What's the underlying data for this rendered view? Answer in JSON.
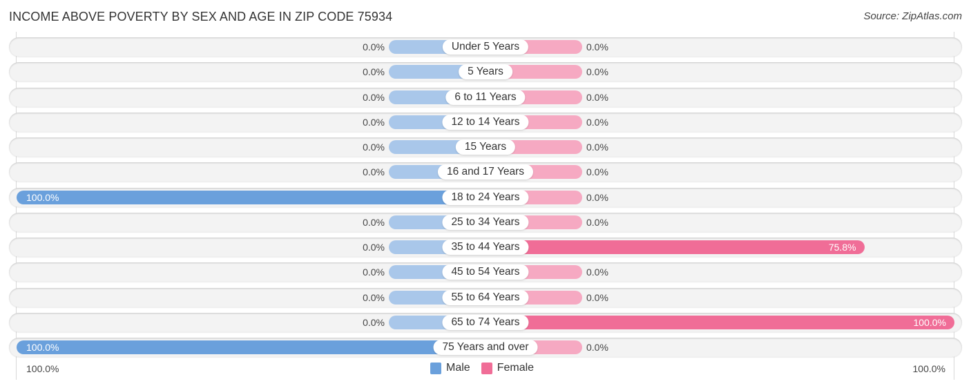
{
  "title": "INCOME ABOVE POVERTY BY SEX AND AGE IN ZIP CODE 75934",
  "source": "Source: ZipAtlas.com",
  "colors": {
    "male": "#6aa0dc",
    "male_zero": "#a9c7ea",
    "female": "#f06d97",
    "female_zero": "#f6a9c2"
  },
  "chart_data": {
    "type": "bar",
    "orientation": "horizontal-diverging",
    "title": "INCOME ABOVE POVERTY BY SEX AND AGE IN ZIP CODE 75934",
    "categories": [
      "Under 5 Years",
      "5 Years",
      "6 to 11 Years",
      "12 to 14 Years",
      "15 Years",
      "16 and 17 Years",
      "18 to 24 Years",
      "25 to 34 Years",
      "35 to 44 Years",
      "45 to 54 Years",
      "55 to 64 Years",
      "65 to 74 Years",
      "75 Years and over"
    ],
    "series": [
      {
        "name": "Male",
        "values": [
          0.0,
          0.0,
          0.0,
          0.0,
          0.0,
          0.0,
          100.0,
          0.0,
          0.0,
          0.0,
          0.0,
          0.0,
          100.0
        ],
        "labels": [
          "0.0%",
          "0.0%",
          "0.0%",
          "0.0%",
          "0.0%",
          "0.0%",
          "100.0%",
          "0.0%",
          "0.0%",
          "0.0%",
          "0.0%",
          "0.0%",
          "100.0%"
        ]
      },
      {
        "name": "Female",
        "values": [
          0.0,
          0.0,
          0.0,
          0.0,
          0.0,
          0.0,
          0.0,
          0.0,
          75.8,
          0.0,
          0.0,
          100.0,
          0.0
        ],
        "labels": [
          "0.0%",
          "0.0%",
          "0.0%",
          "0.0%",
          "0.0%",
          "0.0%",
          "0.0%",
          "0.0%",
          "75.8%",
          "0.0%",
          "0.0%",
          "100.0%",
          "0.0%"
        ]
      }
    ],
    "xlim": [
      0,
      100
    ],
    "axis_labels": {
      "left": "100.0%",
      "right": "100.0%"
    },
    "legend": {
      "position": "bottom-center",
      "entries": [
        "Male",
        "Female"
      ]
    },
    "grid": false
  }
}
